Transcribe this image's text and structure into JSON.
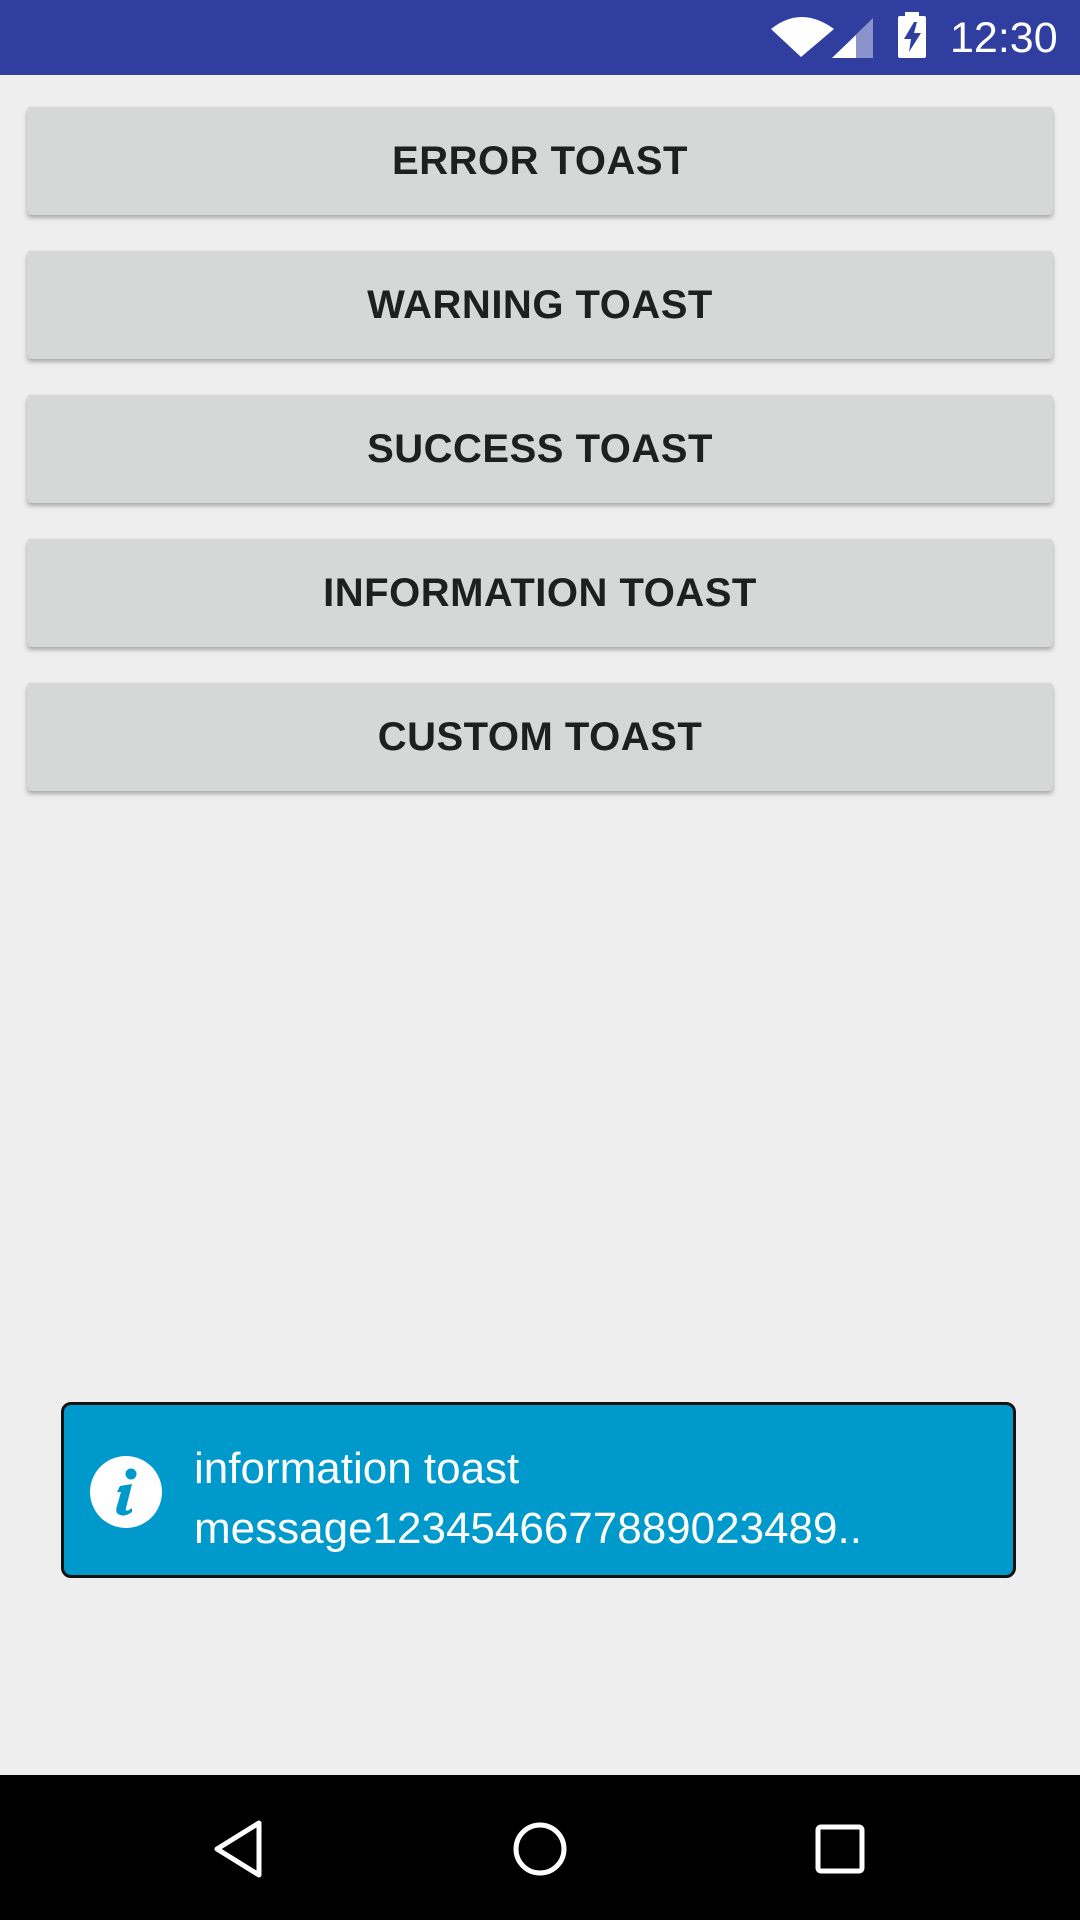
{
  "status_bar": {
    "time": "12:30",
    "icons": [
      "wifi-icon",
      "cellular-signal-icon",
      "battery-charging-icon"
    ],
    "background_color": "#303f9f"
  },
  "buttons": {
    "error": "ERROR TOAST",
    "warning": "WARNING TOAST",
    "success": "SUCCESS TOAST",
    "information": "INFORMATION TOAST",
    "custom": "CUSTOM TOAST"
  },
  "toast": {
    "icon": "info-icon",
    "message": "information toast\nmessage123454667788902348​9..",
    "background_color": "#0099cc"
  },
  "nav_bar": {
    "icons": [
      "back-icon",
      "home-icon",
      "recent-apps-icon"
    ]
  }
}
